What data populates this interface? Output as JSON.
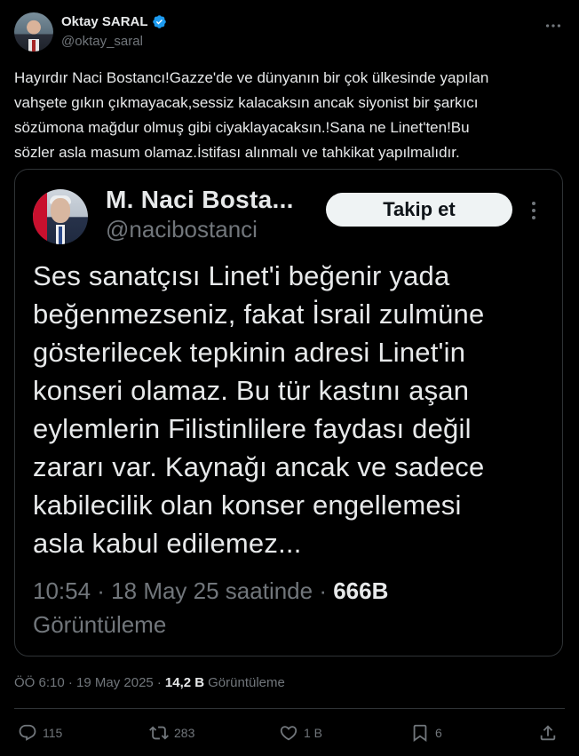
{
  "author": {
    "name": "Oktay SARAL",
    "handle": "@oktay_saral",
    "verified_color": "#1d9bf0"
  },
  "tweet": {
    "text": "Hayırdır Naci Bostancı!Gazze'de ve dünyanın bir çok ülkesinde yapılan\nvahşete gıkın çıkmayacak,sessiz kalacaksın ancak siyonist bir şarkıcı\nsözümona mağdur olmuş gibi ciyaklayacaksın.!Sana ne Linet'ten!Bu\nsözler asla masum olamaz.İstifası alınmalı ve tahkikat yapılmalıdır."
  },
  "embedded": {
    "name": "M. Naci Bosta...",
    "handle": "@nacibostanci",
    "follow_label": "Takip et",
    "text": "Ses sanatçısı Linet'i beğenir yada\nbeğenmezseniz, fakat İsrail zulmüne\ngösterilecek tepkinin adresi Linet'in\nkonseri olamaz. Bu tür kastını aşan\neylemlerin Filistinlilere faydası değil\nzararı var. Kaynağı ancak ve sadece\nkabilecilik olan konser engellemesi\nasla kabul edilemez...",
    "timestamp": "10:54 · 18 May 25 saatinde ·",
    "views_num": "666B",
    "views_label": "Görüntüleme"
  },
  "meta": {
    "time": "ÖÖ 6:10 · 19 May 2025 ·",
    "views_num": "14,2 B",
    "views_label": "Görüntüleme"
  },
  "actions": {
    "replies": "115",
    "reposts": "283",
    "likes": "1 B",
    "bookmarks": "6"
  },
  "icons": [
    "verified-icon",
    "more-icon",
    "reply-icon",
    "repost-icon",
    "like-icon",
    "bookmark-icon",
    "share-icon"
  ]
}
